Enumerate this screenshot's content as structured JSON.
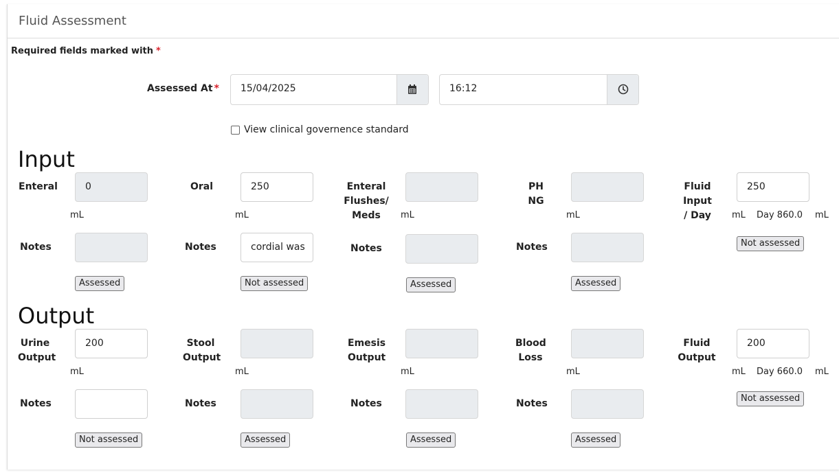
{
  "title": "Fluid Assessment",
  "required_note": "Required fields marked with",
  "required_star": "*",
  "assessed_at": {
    "label": "Assessed At",
    "date": "15/04/2025",
    "time": "16:12"
  },
  "governance_checkbox": {
    "label": "View clinical governence standard",
    "checked": false
  },
  "input": {
    "heading": "Input",
    "enteral": {
      "label": "Enteral",
      "value": "0",
      "unit": "mL",
      "notes_label": "Notes",
      "notes": "",
      "status": "Assessed"
    },
    "oral": {
      "label": "Oral",
      "value": "250",
      "unit": "mL",
      "notes_label": "Notes",
      "notes": "cordial was",
      "status": "Not assessed"
    },
    "flushes": {
      "label_1": "Enteral",
      "label_2": "Flushes/",
      "label_3": "Meds",
      "value": "",
      "unit": "mL",
      "notes_label": "Notes",
      "notes": "",
      "status": "Assessed"
    },
    "ph_ng": {
      "label_1": "PH",
      "label_2": "NG",
      "value": "",
      "unit": "mL",
      "notes_label": "Notes",
      "notes": "",
      "status": "Assessed"
    },
    "total": {
      "label_1": "Fluid",
      "label_2": "Input",
      "label_3": "/ Day",
      "value": "250",
      "unit": "mL",
      "day_text": "Day 860.0",
      "day_unit": "mL",
      "status": "Not assessed"
    }
  },
  "output": {
    "heading": "Output",
    "urine": {
      "label_1": "Urine",
      "label_2": "Output",
      "value": "200",
      "unit": "mL",
      "notes_label": "Notes",
      "notes": "",
      "status": "Not assessed"
    },
    "stool": {
      "label_1": "Stool",
      "label_2": "Output",
      "value": "",
      "unit": "mL",
      "notes_label": "Notes",
      "notes": "",
      "status": "Assessed"
    },
    "emesis": {
      "label_1": "Emesis",
      "label_2": "Output",
      "value": "",
      "unit": "mL",
      "notes_label": "Notes",
      "notes": "",
      "status": "Assessed"
    },
    "blood": {
      "label_1": "Blood",
      "label_2": "Loss",
      "value": "",
      "unit": "mL",
      "notes_label": "Notes",
      "notes": "",
      "status": "Assessed"
    },
    "total": {
      "label_1": "Fluid",
      "label_2": "Output",
      "value": "200",
      "unit": "mL",
      "day_text": "Day 660.0",
      "day_unit": "mL",
      "status": "Not assessed"
    }
  },
  "icons": {
    "calendar": "calendar-icon",
    "clock": "clock-icon"
  },
  "colors": {
    "required_star": "#d9232d",
    "disabled_field": "#e9ecef"
  }
}
